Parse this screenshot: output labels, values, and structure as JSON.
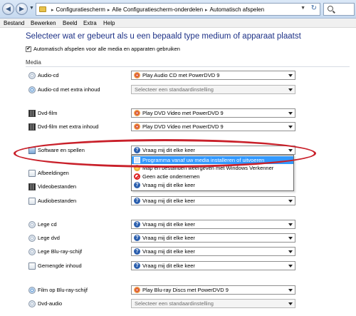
{
  "addressbar": {
    "crumbs": [
      "Configuratiescherm",
      "Alle Configuratiescherm-onderdelen",
      "Automatisch afspelen"
    ],
    "refresh_icon": "refresh-icon",
    "search_icon": "search-icon"
  },
  "menu": [
    "Bestand",
    "Bewerken",
    "Beeld",
    "Extra",
    "Help"
  ],
  "heading": "Selecteer wat er gebeurt als u een bepaald type medium of apparaat plaatst",
  "autoplay_checkbox": {
    "checked": true,
    "label": "Automatisch afspelen voor alle media en apparaten gebruiken"
  },
  "section_label": "Media",
  "rows": [
    {
      "label": "Audio-cd",
      "icon": "audio-cd-icon",
      "value": "Play Audio CD met PowerDVD 9",
      "value_icon": "powerdvd-icon"
    },
    {
      "label": "Audio-cd met extra inhoud",
      "icon": "audio-cd-icon",
      "value": "Selecteer een standaardinstelling",
      "value_icon": ""
    },
    {
      "label": "Dvd-film",
      "icon": "dvd-icon",
      "value": "Play DVD Video met PowerDVD 9",
      "value_icon": "powerdvd-icon"
    },
    {
      "label": "Dvd-film met extra inhoud",
      "icon": "dvd-icon",
      "value": "Play DVD Video met PowerDVD 9",
      "value_icon": "powerdvd-icon"
    },
    {
      "label": "Software en spellen",
      "icon": "software-icon",
      "value": "Vraag mij dit elke keer",
      "value_icon": "question-icon"
    },
    {
      "label": "Afbeeldingen",
      "icon": "pictures-icon",
      "value": "",
      "value_icon": ""
    },
    {
      "label": "Videobestanden",
      "icon": "video-files-icon",
      "value": "",
      "value_icon": ""
    },
    {
      "label": "Audiobestanden",
      "icon": "audio-files-icon",
      "value": "Vraag mij dit elke keer",
      "value_icon": "question-icon"
    },
    {
      "label": "Lege cd",
      "icon": "blank-cd-icon",
      "value": "Vraag mij dit elke keer",
      "value_icon": "question-icon"
    },
    {
      "label": "Lege dvd",
      "icon": "blank-dvd-icon",
      "value": "Vraag mij dit elke keer",
      "value_icon": "question-icon"
    },
    {
      "label": "Lege Blu-ray-schijf",
      "icon": "blank-bluray-icon",
      "value": "Vraag mij dit elke keer",
      "value_icon": "question-icon"
    },
    {
      "label": "Gemengde inhoud",
      "icon": "mixed-content-icon",
      "value": "Vraag mij dit elke keer",
      "value_icon": "question-icon"
    },
    {
      "label": "Film op Blu-ray-schijf",
      "icon": "bluray-movie-icon",
      "value": "Play Blu-ray Discs met PowerDVD 9",
      "value_icon": "powerdvd-icon"
    },
    {
      "label": "Dvd-audio",
      "icon": "dvd-audio-icon",
      "value": "Selecteer een standaardinstelling",
      "value_icon": ""
    }
  ],
  "dropdown": {
    "items": [
      {
        "label": "Programma vanaf uw media installeren of uitvoeren",
        "selected": true,
        "icon": "install-icon"
      },
      {
        "label": "Map en bestanden weergeven met Windows Verkenner",
        "selected": false,
        "icon": "media-player-icon"
      },
      {
        "label": "Geen actie ondernemen",
        "selected": false,
        "icon": "no-action-icon"
      },
      {
        "label": "Vraag mij dit elke keer",
        "selected": false,
        "icon": "question-icon"
      }
    ]
  },
  "colors": {
    "heading": "#1e3287",
    "highlight": "#3399ff",
    "annotation": "#c9202a"
  }
}
